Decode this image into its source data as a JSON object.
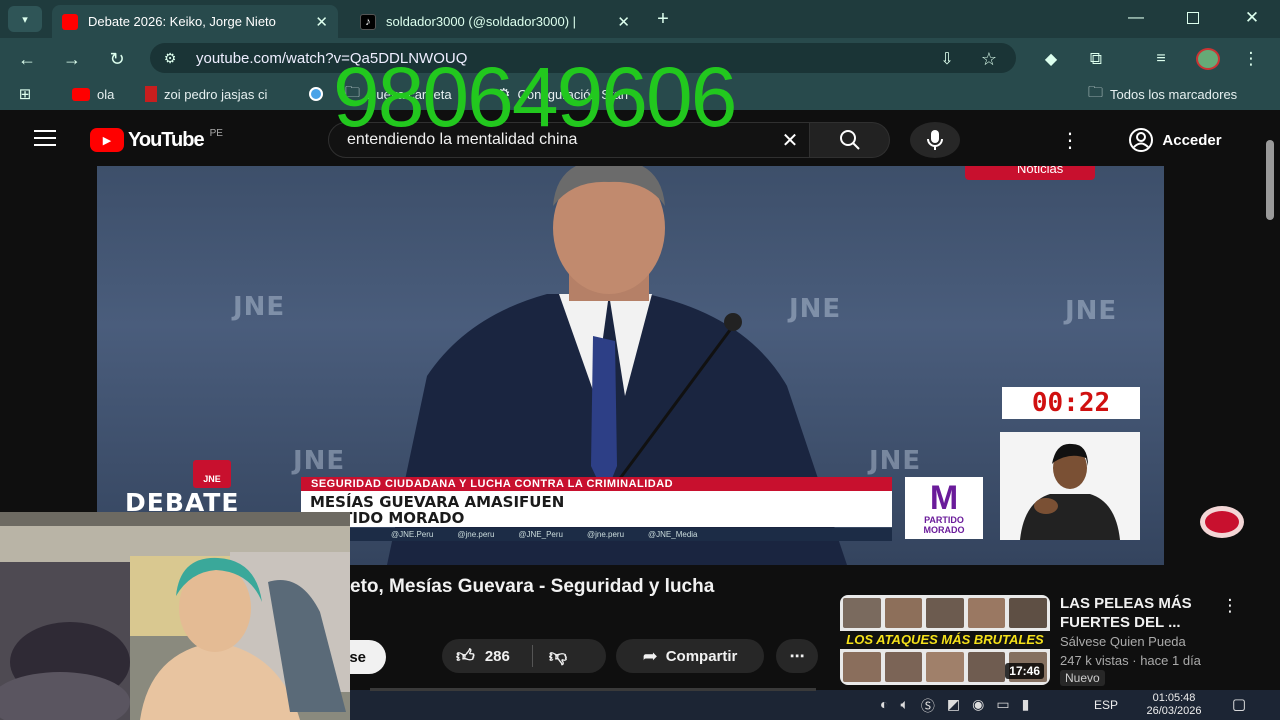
{
  "browser": {
    "tabs": [
      {
        "title": "Debate 2026: Keiko, Jorge Nieto",
        "favicon": "youtube-icon",
        "active": true
      },
      {
        "title": "soldador3000 (@soldador3000) |",
        "favicon": "tiktok-icon",
        "active": false
      }
    ],
    "url": "youtube.com/watch?v=Qa5DDLNWOUQ",
    "bookmarks": [
      {
        "label": "ola",
        "icon": "youtube-icon"
      },
      {
        "label": "zoi pedro jasjas ci",
        "icon": "bookmark-red-icon"
      },
      {
        "label": "",
        "icon": "circle-icon"
      },
      {
        "label": "Nueva carpeta",
        "icon": "folder-icon"
      },
      {
        "label": "Configuración Starr",
        "icon": "gear-icon"
      }
    ],
    "all_bookmarks": "Todos los marcadores"
  },
  "overlay_phone": "980649606",
  "youtube": {
    "logo": "YouTube",
    "region": "PE",
    "search_query": "entendiendo la mentalidad china",
    "sign_in": "Acceder"
  },
  "video": {
    "timer": "00:22",
    "topic": "SEGURIDAD CIUDADANA Y LUCHA CONTRA LA CRIMINALIDAD",
    "speaker_name": "MESÍAS GUEVARA AMASIFUEN",
    "speaker_party": "PARTIDO MORADO",
    "party_logo_letter": "M",
    "party_logo_text1": "PARTIDO",
    "party_logo_text2": "MORADO",
    "debate_word": "DEBATE",
    "channel_badge": "Noticias",
    "watermark": "JNE",
    "socials": [
      "@JNE.Peru",
      "@jne.peru",
      "@JNE_Peru",
      "@jne.peru",
      "@JNE_Media"
    ],
    "title_partial": "eto, Mesías Guevara - Seguridad y lucha",
    "subscribe_partial": "se",
    "likes": "286",
    "share": "Compartir",
    "more": "⋯"
  },
  "sidebar_video": {
    "thumb_caption": "LOS ATAQUES MÁS BRUTALES",
    "duration": "17:46",
    "title": "LAS PELEAS MÁS FUERTES DEL ...",
    "channel": "Sálvese Quien Pueda",
    "meta": "247 k vistas · hace 1 día",
    "badge": "Nuevo"
  },
  "taskbar": {
    "language": "ESP",
    "time": "01:05:48",
    "date": "26/03/2026"
  },
  "colors": {
    "chrome_dark": "#1f3b3d",
    "chrome_toolbar": "#284a4c",
    "youtube_red": "#ff0000",
    "debate_red": "#c8102e",
    "party_purple": "#6a1b9a",
    "overlay_green": "#22c81e"
  }
}
